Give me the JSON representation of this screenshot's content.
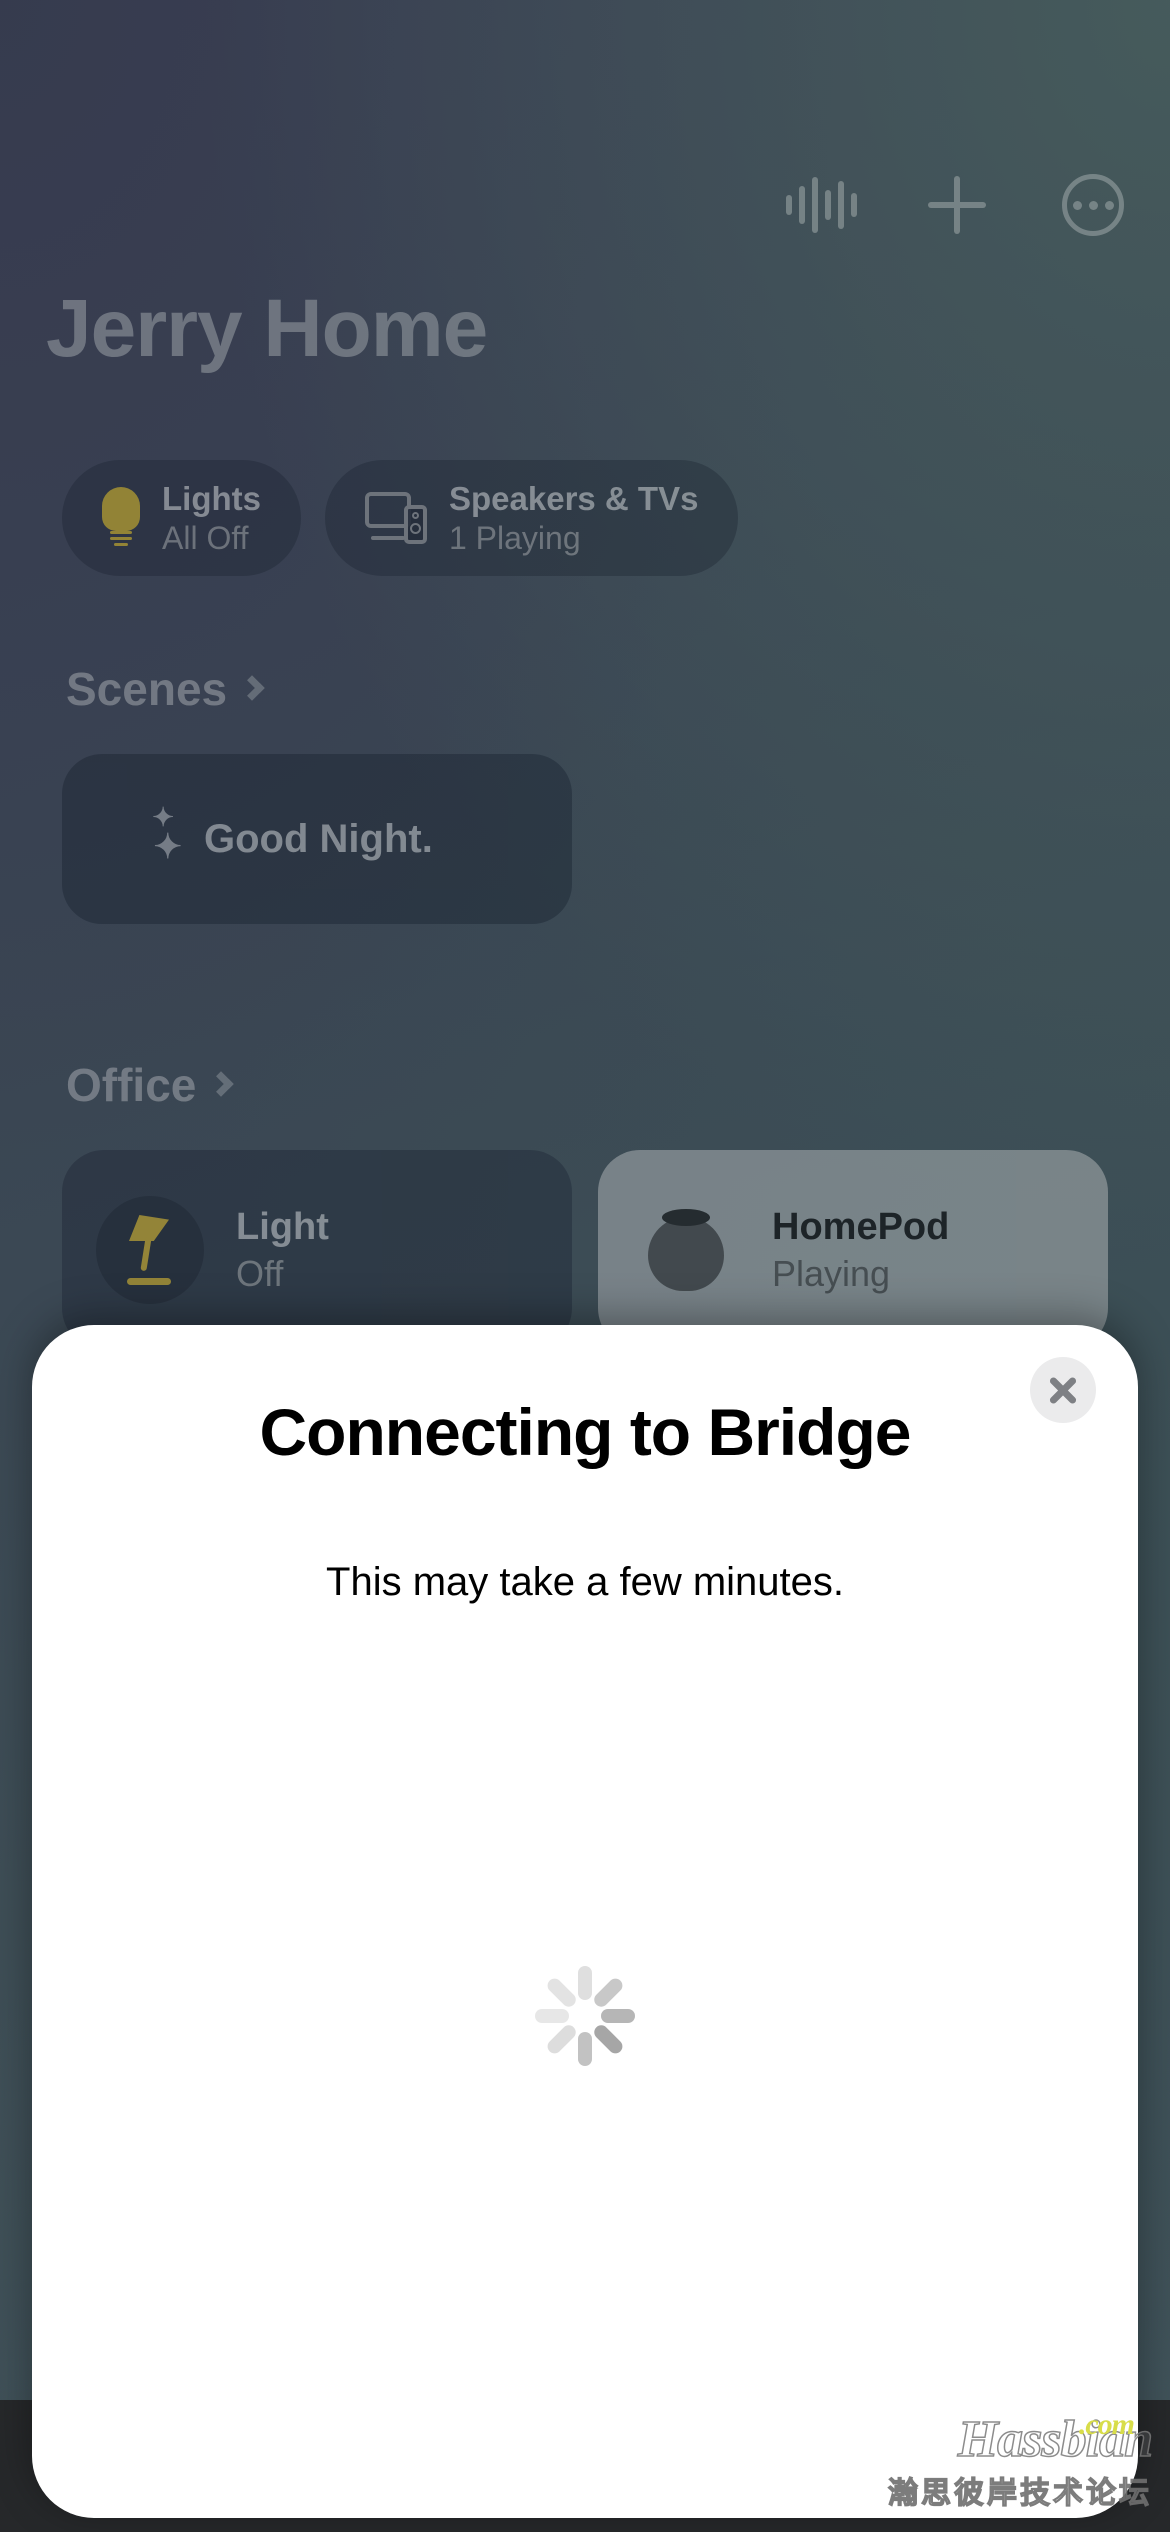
{
  "app": {
    "home_title": "Jerry Home"
  },
  "topbar": {
    "icons": [
      {
        "name": "waveform-icon",
        "label": "Siri Waveform"
      },
      {
        "name": "plus-icon",
        "label": "Add"
      },
      {
        "name": "more-icon",
        "label": "More"
      }
    ]
  },
  "status_pills": [
    {
      "icon": "lightbulb-icon",
      "title": "Lights",
      "subtitle": "All Off"
    },
    {
      "icon": "speakers-tv-icon",
      "title": "Speakers & TVs",
      "subtitle": "1 Playing"
    }
  ],
  "sections": [
    {
      "header": "Scenes",
      "chevron": "chevron-right-icon",
      "cards": [
        {
          "icon": "moon-stars-icon",
          "label": "Good Night."
        }
      ]
    },
    {
      "header": "Office",
      "chevron": "chevron-right-icon",
      "cards": [
        {
          "icon": "desk-lamp-icon",
          "title": "Light",
          "subtitle": "Off",
          "state": "off"
        },
        {
          "icon": "homepod-icon",
          "title": "HomePod",
          "subtitle": "Playing",
          "state": "active"
        }
      ]
    }
  ],
  "sheet": {
    "title": "Connecting to Bridge",
    "subtitle": "This may take a few minutes.",
    "close_icon": "close-icon",
    "spinner": "loading-spinner",
    "background": "#ffffff"
  },
  "watermark": {
    "main": "Hassbian",
    "tld": ".com",
    "cn": "瀚思彼岸技术论坛"
  },
  "colors": {
    "accent_yellow": "#c9a927",
    "sheet_bg": "#ffffff",
    "bg_top_right": "#3a4a4d",
    "bg_top_left": "#363b4e",
    "active_card": "#c4c6c8"
  }
}
